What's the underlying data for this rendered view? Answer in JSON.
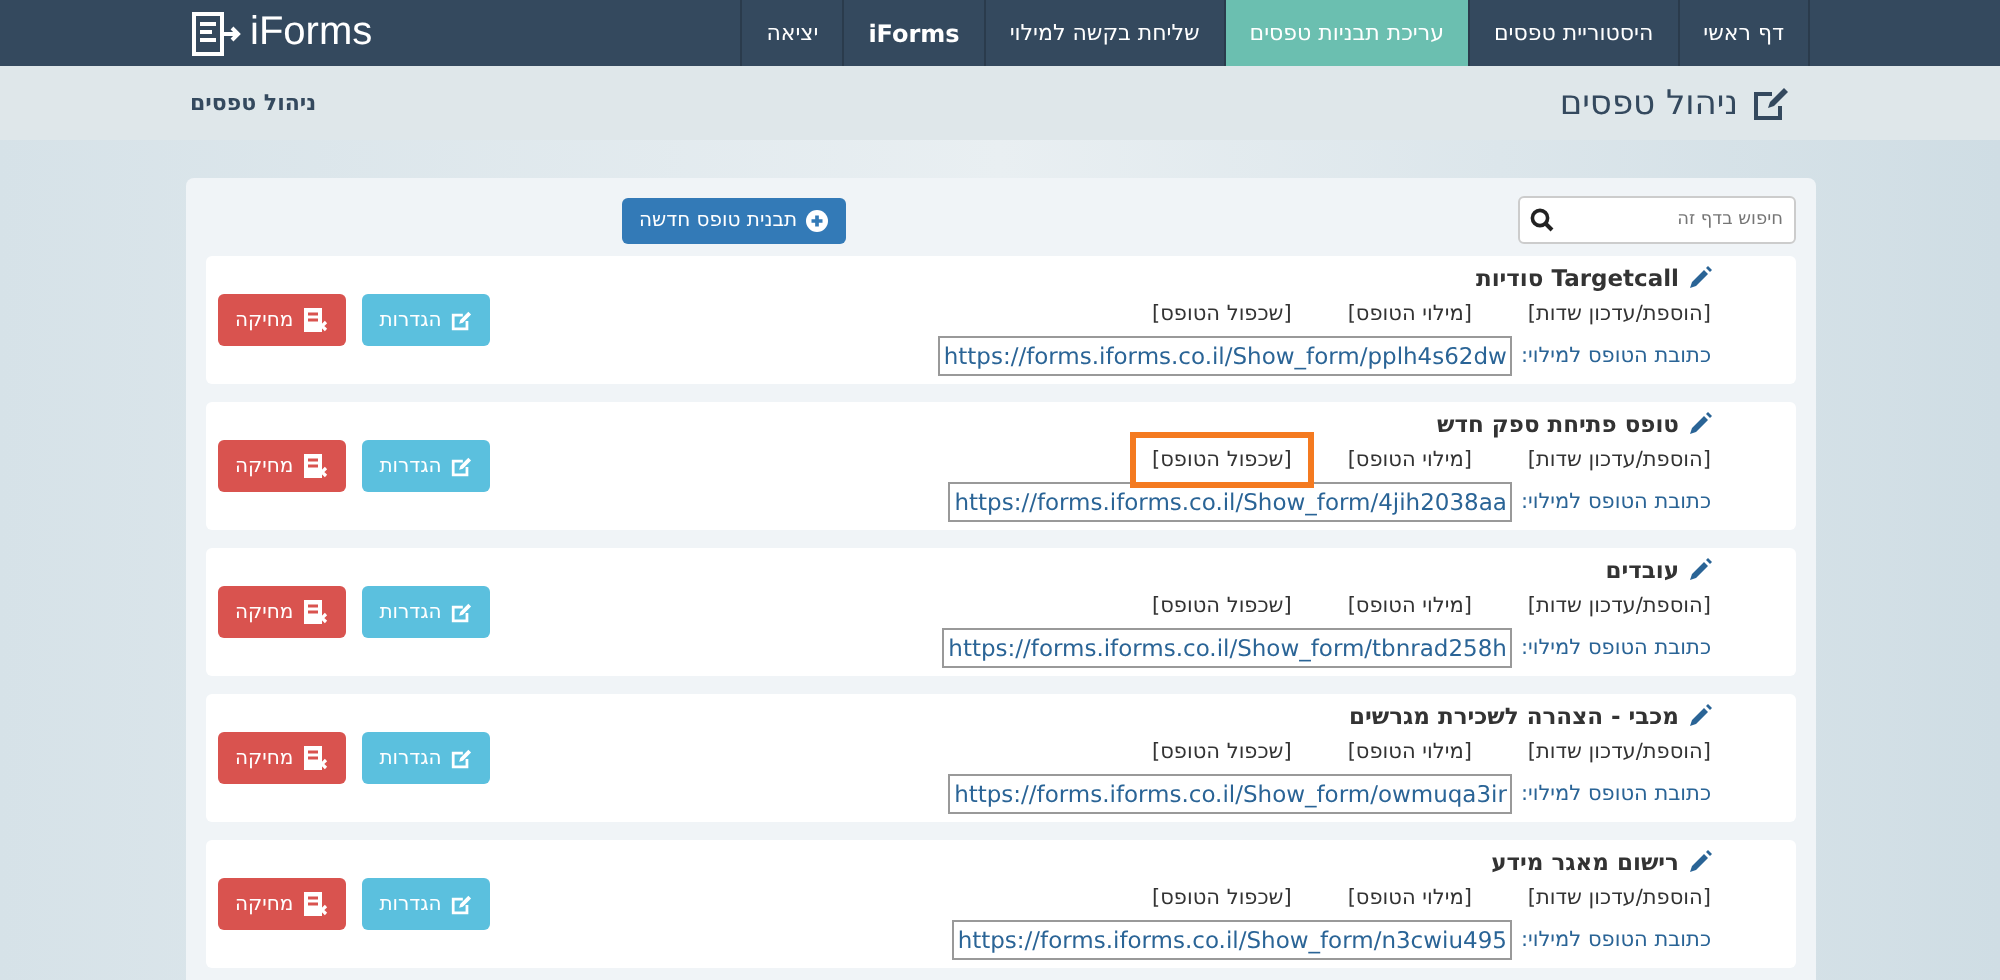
{
  "logo": {
    "text": "iForms"
  },
  "nav": [
    {
      "label": "דף ראשי",
      "selected": false
    },
    {
      "label": "היסטוריית טפסים",
      "selected": false
    },
    {
      "label": "עריכת תבניות טפסים",
      "selected": true
    },
    {
      "label": "שליחת בקשה למילוי",
      "selected": false
    },
    {
      "label": "iForms",
      "selected": false,
      "kind": "brand"
    },
    {
      "label": "יציאה",
      "selected": false
    }
  ],
  "page_title": "ניהול טפסים",
  "breadcrumb": "ניהול טפסים",
  "search": {
    "placeholder": "חיפוש בדף זה"
  },
  "new_button": "תבנית טופס חדשה",
  "forms": [
    {
      "title": "Targetcall סודיות",
      "links": [
        {
          "label": "[הוספת/עדכון שדות]",
          "highlighted": false
        },
        {
          "label": "[מילוי הטופס]",
          "highlighted": false
        },
        {
          "label": "[שכפול הטופס]",
          "highlighted": false
        }
      ],
      "url_label": "כתובת הטופס למילוי:",
      "url": "https://forms.iforms.co.il/Show_form/pplh4s62dw",
      "settings": "הגדרות",
      "delete": "מחיקה"
    },
    {
      "title": "טופס פתיחת ספק חדש",
      "links": [
        {
          "label": "[הוספת/עדכון שדות]",
          "highlighted": false
        },
        {
          "label": "[מילוי הטופס]",
          "highlighted": false
        },
        {
          "label": "[שכפול הטופס]",
          "highlighted": true
        }
      ],
      "url_label": "כתובת הטופס למילוי:",
      "url": "https://forms.iforms.co.il/Show_form/4jih2038aa",
      "settings": "הגדרות",
      "delete": "מחיקה"
    },
    {
      "title": "עובדים",
      "links": [
        {
          "label": "[הוספת/עדכון שדות]",
          "highlighted": false
        },
        {
          "label": "[מילוי הטופס]",
          "highlighted": false
        },
        {
          "label": "[שכפול הטופס]",
          "highlighted": false
        }
      ],
      "url_label": "כתובת הטופס למילוי:",
      "url": "https://forms.iforms.co.il/Show_form/tbnrad258h",
      "settings": "הגדרות",
      "delete": "מחיקה"
    },
    {
      "title": "מכבי - הצהרה לשכירת מגרשים",
      "links": [
        {
          "label": "[הוספת/עדכון שדות]",
          "highlighted": false
        },
        {
          "label": "[מילוי הטופס]",
          "highlighted": false
        },
        {
          "label": "[שכפול הטופס]",
          "highlighted": false
        }
      ],
      "url_label": "כתובת הטופס למילוי:",
      "url": "https://forms.iforms.co.il/Show_form/owmuqa3ir",
      "settings": "הגדרות",
      "delete": "מחיקה"
    },
    {
      "title": "רישום מאגר מידע",
      "links": [
        {
          "label": "[הוספת/עדכון שדות]",
          "highlighted": false
        },
        {
          "label": "[מילוי הטופס]",
          "highlighted": false
        },
        {
          "label": "[שכפול הטופס]",
          "highlighted": false
        }
      ],
      "url_label": "כתובת הטופס למילוי:",
      "url": "https://forms.iforms.co.il/Show_form/n3cwiu495",
      "settings": "הגדרות",
      "delete": "מחיקה"
    }
  ]
}
